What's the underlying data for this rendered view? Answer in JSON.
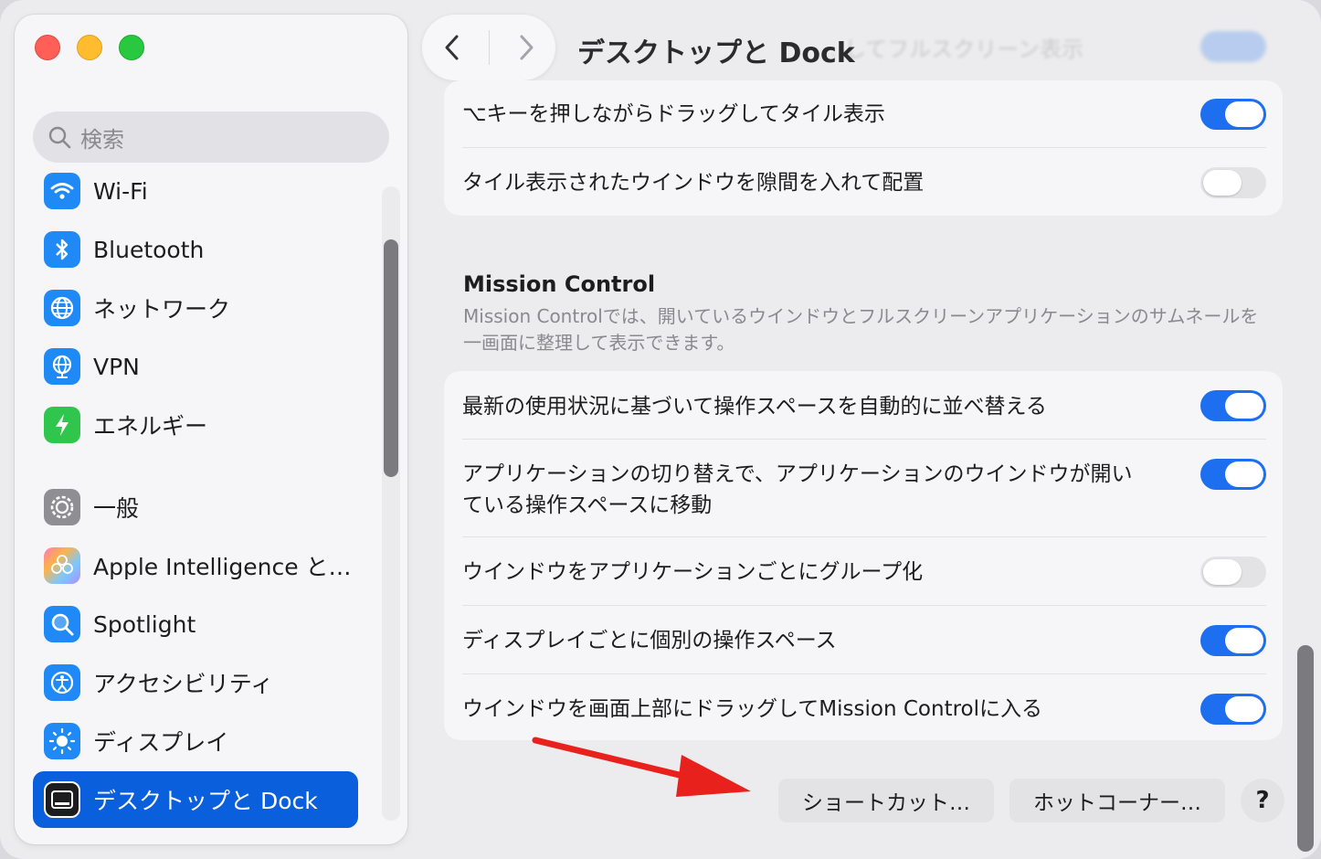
{
  "window": {
    "title": "デスクトップと Dock",
    "ghost_header_text": "…してフルスクリーン表示"
  },
  "sidebar": {
    "search_placeholder": "検索",
    "items": [
      {
        "label": "Wi-Fi",
        "icon": "wifi-icon"
      },
      {
        "label": "Bluetooth",
        "icon": "bluetooth-icon"
      },
      {
        "label": "ネットワーク",
        "icon": "globe-icon"
      },
      {
        "label": "VPN",
        "icon": "vpn-globe-icon"
      },
      {
        "label": "エネルギー",
        "icon": "bolt-icon"
      },
      {
        "label": "一般",
        "icon": "gear-icon"
      },
      {
        "label": "Apple Intelligence と…",
        "icon": "apple-intelligence-icon"
      },
      {
        "label": "Spotlight",
        "icon": "magnifier-icon"
      },
      {
        "label": "アクセシビリティ",
        "icon": "accessibility-icon"
      },
      {
        "label": "ディスプレイ",
        "icon": "sun-icon"
      },
      {
        "label": "デスクトップと Dock",
        "icon": "dock-icon",
        "active": true
      }
    ]
  },
  "tiling": {
    "rows": [
      {
        "label": "⌥キーを押しながらドラッグしてタイル表示",
        "on": true
      },
      {
        "label": "タイル表示されたウインドウを隙間を入れて配置",
        "on": false
      }
    ]
  },
  "mission_control": {
    "title": "Mission Control",
    "description": "Mission Controlでは、開いているウインドウとフルスクリーンアプリケーションのサムネールを一画面に整理して表示できます。",
    "rows": [
      {
        "label": "最新の使用状況に基づいて操作スペースを自動的に並べ替える",
        "on": true
      },
      {
        "label": "アプリケーションの切り替えで、アプリケーションのウインドウが開いている操作スペースに移動",
        "on": true
      },
      {
        "label": "ウインドウをアプリケーションごとにグループ化",
        "on": false
      },
      {
        "label": "ディスプレイごとに個別の操作スペース",
        "on": true
      },
      {
        "label": "ウインドウを画面上部にドラッグしてMission Controlに入る",
        "on": true
      }
    ]
  },
  "buttons": {
    "shortcuts": "ショートカット…",
    "hot_corners": "ホットコーナー…",
    "help": "?"
  },
  "colors": {
    "accent": "#1d6ff0",
    "sidebar_selected": "#0a5fdc",
    "annotation_arrow": "#e8211c"
  }
}
